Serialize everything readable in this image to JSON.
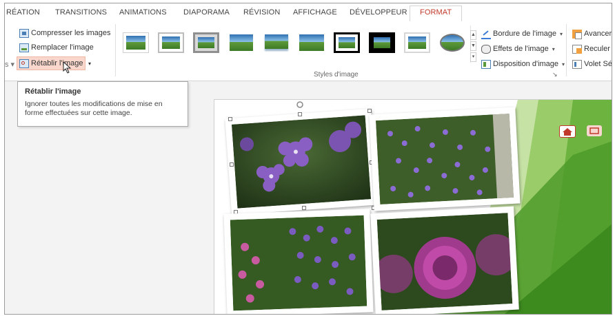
{
  "tabs": [
    {
      "label": "RÉATION"
    },
    {
      "label": "TRANSITIONS"
    },
    {
      "label": "ANIMATIONS"
    },
    {
      "label": "DIAPORAMA"
    },
    {
      "label": "RÉVISION"
    },
    {
      "label": "AFFICHAGE"
    },
    {
      "label": "DÉVELOPPEUR"
    },
    {
      "label": "FORMAT",
      "active": true
    }
  ],
  "adjust": {
    "compress_label": "Compresser les images",
    "replace_label": "Remplacer l'image",
    "reset_label": "Rétablir l'image"
  },
  "styles": {
    "group_label": "Styles d'image",
    "border_label": "Bordure de l'image",
    "effects_label": "Effets de l'image",
    "layout_label": "Disposition d'image"
  },
  "arrange": {
    "forward_label": "Avancer",
    "backward_label": "Reculer",
    "pane_label": "Volet Séle"
  },
  "tooltip": {
    "title": "Rétablir l'image",
    "description": "Ignorer toutes les modifications de mise en forme effectuées sur cette image."
  },
  "colors": {
    "accent": "#c0392b",
    "slide_green": "#6db33f",
    "highlight": "#f9d7cc"
  },
  "icons": {
    "home": "home-icon",
    "link": "link-icon"
  }
}
